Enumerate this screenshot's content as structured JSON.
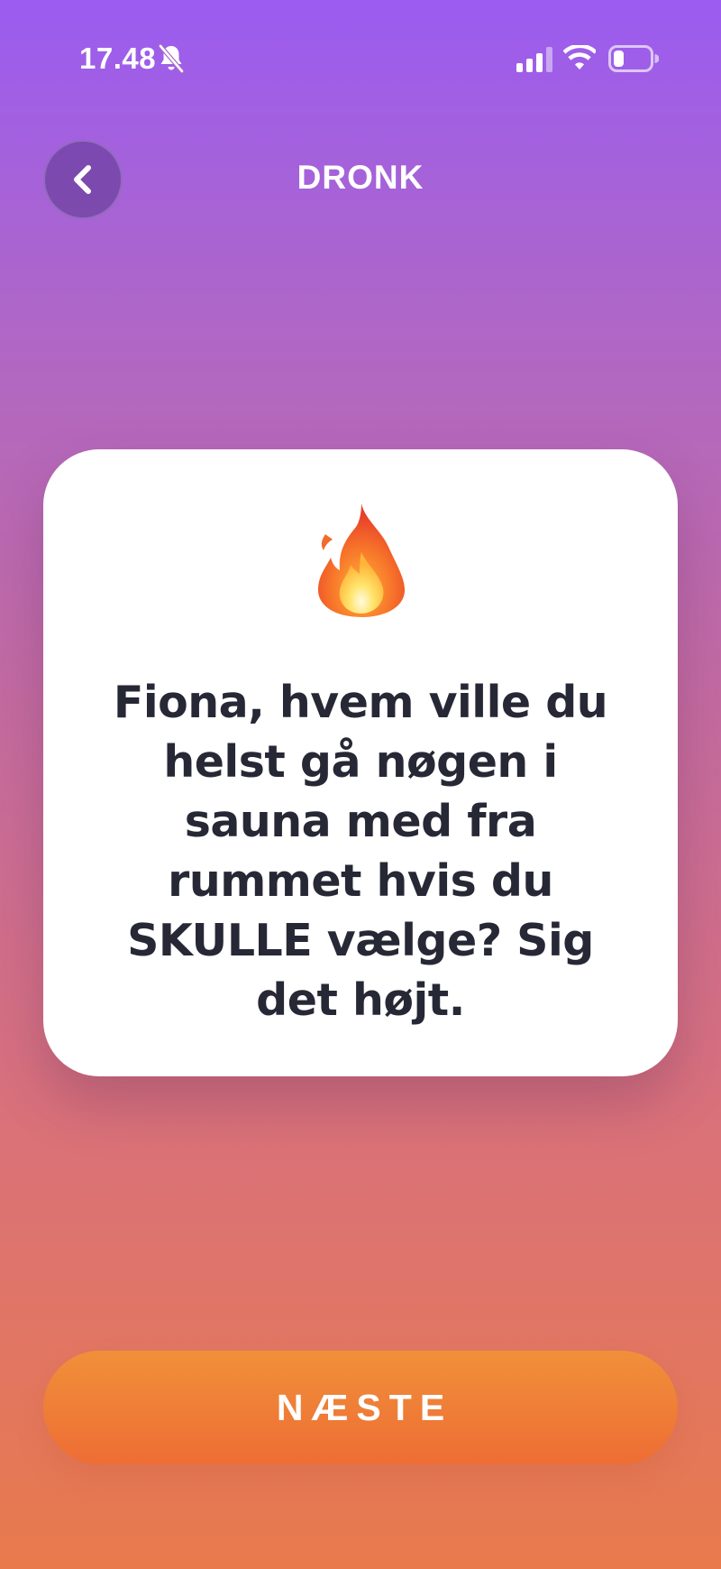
{
  "status_bar": {
    "time": "17.48",
    "icons": [
      "bell-slash-icon",
      "signal-icon",
      "wifi-icon",
      "battery-icon"
    ]
  },
  "header": {
    "back_icon": "chevron-left-icon",
    "title": "DRONK"
  },
  "card": {
    "emoji": "🔥",
    "emoji_icon": "fire-icon",
    "question": "Fiona, hvem ville du helst gå nøgen i sauna med fra rummet hvis du SKULLE vælge? Sig det højt."
  },
  "next_button": {
    "label": "NÆSTE"
  },
  "colors": {
    "background_top": "#9b5cf0",
    "background_bottom": "#e87a4c",
    "card_bg": "#ffffff",
    "card_text": "#272835",
    "button_top": "#f0903a",
    "button_bottom": "#ee6d34"
  }
}
